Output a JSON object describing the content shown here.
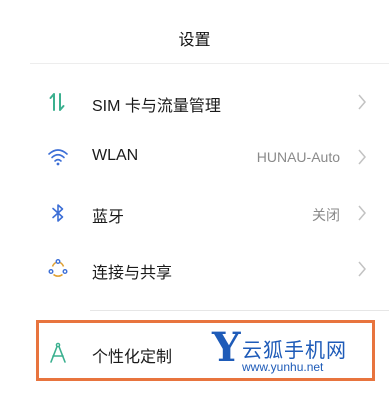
{
  "header": {
    "title": "设置"
  },
  "settings": {
    "items": [
      {
        "label": "SIM 卡与流量管理",
        "value": "",
        "icon": "sim-data-arrows-icon"
      },
      {
        "label": "WLAN",
        "value": "HUNAU-Auto",
        "icon": "wifi-icon"
      },
      {
        "label": "蓝牙",
        "value": "关闭",
        "icon": "bluetooth-icon"
      },
      {
        "label": "连接与共享",
        "value": "",
        "icon": "connection-share-icon"
      },
      {
        "label": "个性化定制",
        "value": "",
        "icon": "personalization-icon"
      }
    ]
  },
  "colors": {
    "accent_green": "#3bb08f",
    "highlight_border": "#e8743e",
    "watermark_blue": "#1e5bb8"
  },
  "watermark": {
    "letter": "Y",
    "name": "云狐手机网",
    "url": "www.yunhu.net"
  }
}
